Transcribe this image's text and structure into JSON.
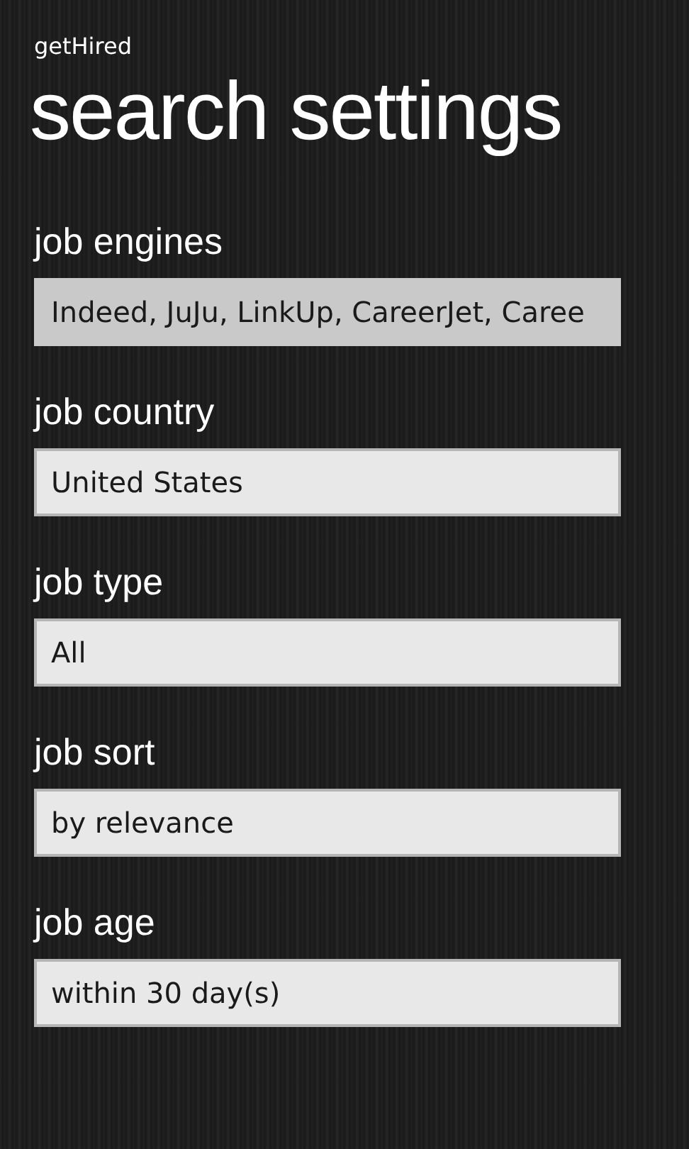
{
  "app_title": "getHired",
  "page_title": "search settings",
  "settings": [
    {
      "label": "job engines",
      "value": "Indeed, JuJu, LinkUp, CareerJet, Caree",
      "selected": true
    },
    {
      "label": "job country",
      "value": "United States",
      "selected": false
    },
    {
      "label": "job type",
      "value": "All",
      "selected": false
    },
    {
      "label": "job sort",
      "value": "by relevance",
      "selected": false
    },
    {
      "label": "job age",
      "value": "within 30 day(s)",
      "selected": false
    }
  ]
}
